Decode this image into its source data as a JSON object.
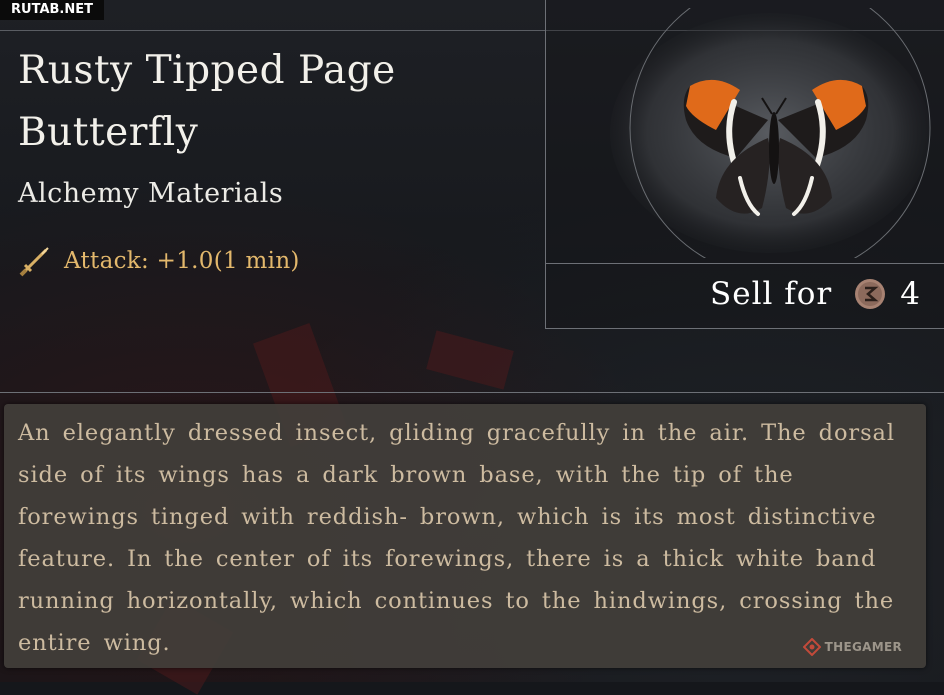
{
  "site_tag": "RUTAB.NET",
  "item": {
    "title": "Rusty Tipped Page Butterfly",
    "category": "Alchemy Materials",
    "stat": {
      "icon": "sword-icon",
      "text": "Attack: +1.0(1 min)"
    },
    "image": "butterfly-icon",
    "sell": {
      "label": "Sell for",
      "icon": "coin-icon",
      "value": "4"
    },
    "description": "An elegantly dressed insect, gliding gracefully in the air. The dorsal side of its wings has a dark brown base, with the tip of the forewings tinged with reddish- brown, which is its most distinctive feature. In the center of its forewings, there is a thick white band running horizontally, which continues to the hindwings, crossing the entire wing."
  },
  "watermark": {
    "icon": "thegamer-logo-icon",
    "text": "THEGAMER"
  },
  "colors": {
    "stat_text": "#e3b86c",
    "description_text": "#cdbba0",
    "description_panel": "#423e3a",
    "wing_tip": "#e06a1a",
    "title_text": "#f2f0ea"
  }
}
